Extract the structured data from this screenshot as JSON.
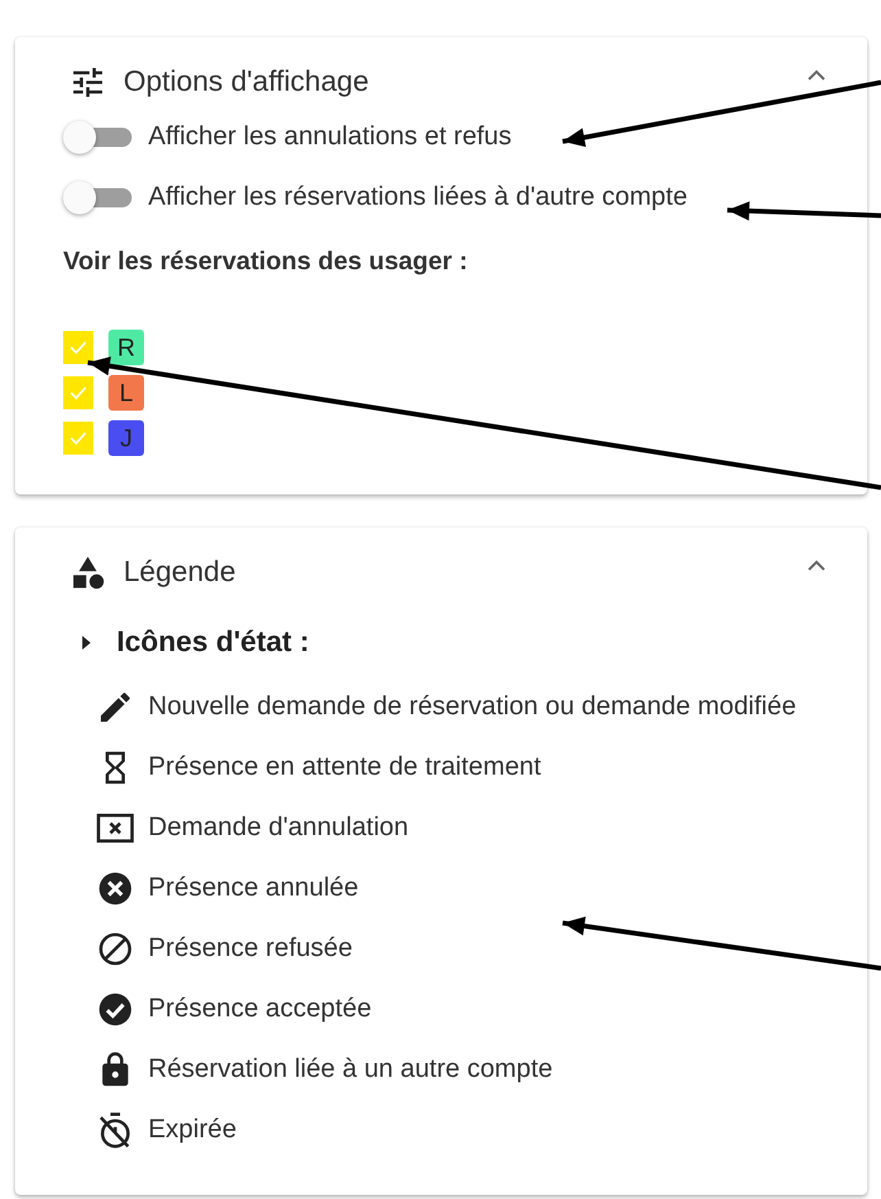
{
  "display_options": {
    "title": "Options d'affichage",
    "expanded": true,
    "toggles": [
      {
        "label": "Afficher les annulations et refus",
        "on": false
      },
      {
        "label": "Afficher les réservations liées à d'autre compte",
        "on": false
      }
    ],
    "users_label": "Voir les réservations des usager :",
    "users": [
      {
        "initial": "R",
        "color": "#4eeaa4",
        "checked": true
      },
      {
        "initial": "L",
        "color": "#f2784b",
        "checked": true
      },
      {
        "initial": "J",
        "color": "#4a4ef0",
        "checked": true
      }
    ]
  },
  "legend": {
    "title": "Légende",
    "expanded": true,
    "section_title": "Icônes d'état :",
    "items": [
      {
        "kind": "pencil",
        "label": "Nouvelle demande de réservation ou demande modifiée"
      },
      {
        "kind": "hourglass",
        "label": "Présence en attente de traitement"
      },
      {
        "kind": "cancel-request",
        "label": "Demande d'annulation"
      },
      {
        "kind": "cancelled",
        "label": "Présence annulée"
      },
      {
        "kind": "refused",
        "label": "Présence refusée"
      },
      {
        "kind": "accepted",
        "label": "Présence acceptée"
      },
      {
        "kind": "lock",
        "label": "Réservation liée à un autre compte"
      },
      {
        "kind": "expired",
        "label": "Expirée"
      }
    ]
  }
}
